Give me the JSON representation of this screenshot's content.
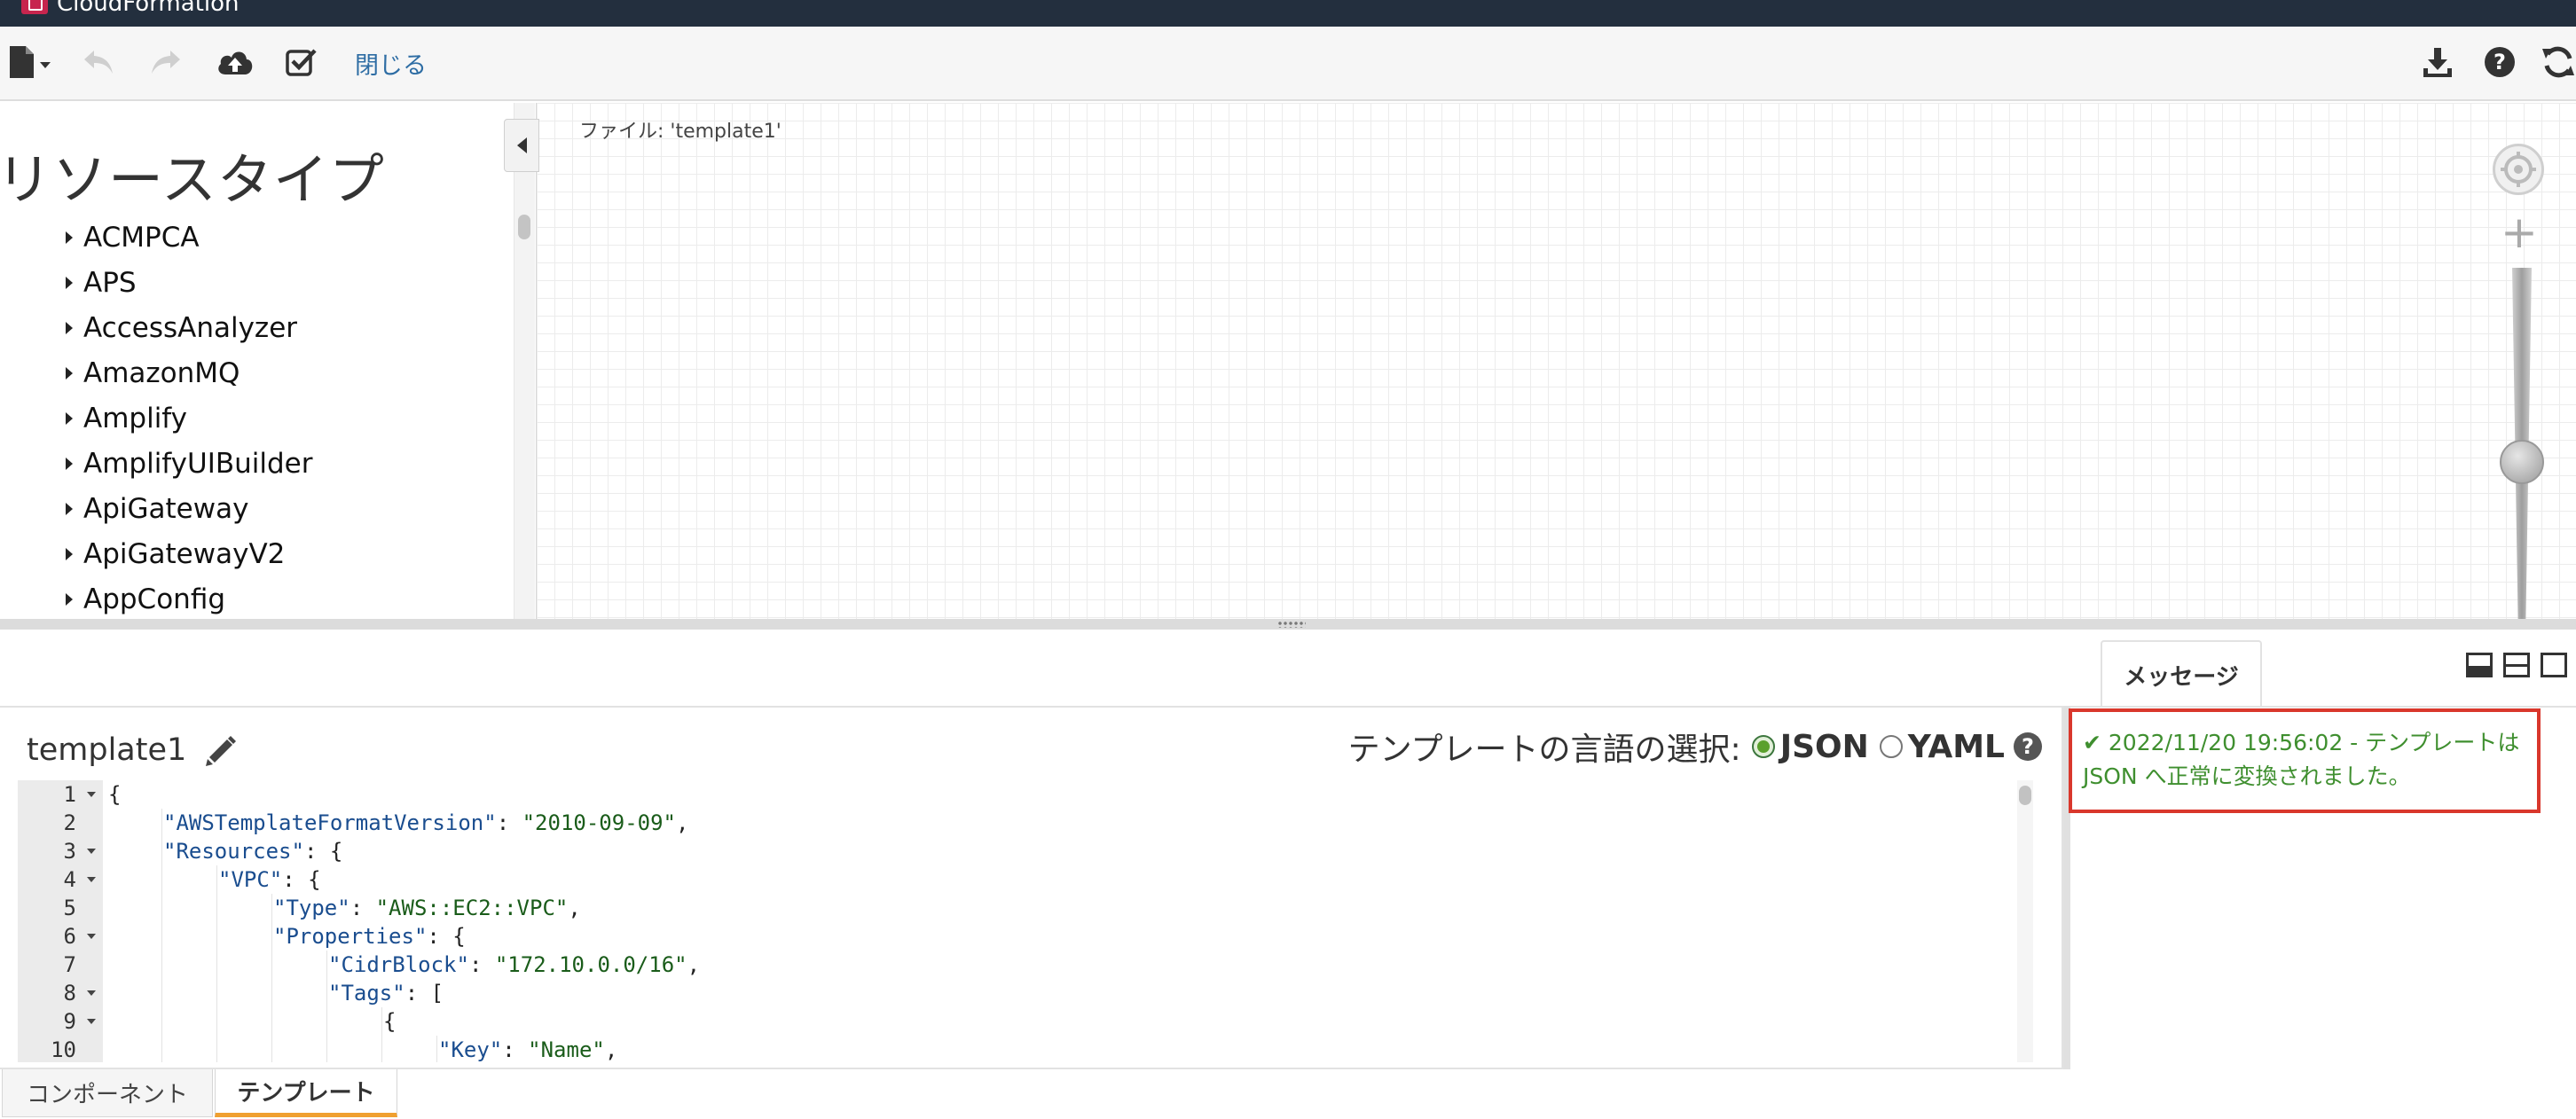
{
  "window": {
    "app_name": "CloudFormation"
  },
  "toolbar": {
    "close_label": "閉じる",
    "icons": [
      "file-icon",
      "undo-icon",
      "redo-icon",
      "cloud-upload-icon",
      "validate-icon",
      "download-icon",
      "help-icon",
      "refresh-icon"
    ]
  },
  "resources": {
    "title": "リソースタイプ",
    "items": [
      "ACMPCA",
      "APS",
      "AccessAnalyzer",
      "AmazonMQ",
      "Amplify",
      "AmplifyUIBuilder",
      "ApiGateway",
      "ApiGatewayV2",
      "AppConfig"
    ]
  },
  "canvas": {
    "file_label": "ファイル: 'template1'"
  },
  "editor": {
    "template_name": "template1",
    "lang_label": "テンプレートの言語の選択:",
    "lang_options": [
      "JSON",
      "YAML"
    ],
    "selected_lang": "JSON",
    "lines": [
      {
        "n": "1",
        "fold": true,
        "indent": 0,
        "key": "",
        "text": "{"
      },
      {
        "n": "2",
        "fold": false,
        "indent": 1,
        "key": "\"AWSTemplateFormatVersion\"",
        "sep": ": ",
        "val": "\"2010-09-09\"",
        "tail": ","
      },
      {
        "n": "3",
        "fold": true,
        "indent": 1,
        "key": "\"Resources\"",
        "sep": ": ",
        "val": "",
        "tail": "{"
      },
      {
        "n": "4",
        "fold": true,
        "indent": 2,
        "key": "\"VPC\"",
        "sep": ": ",
        "val": "",
        "tail": "{"
      },
      {
        "n": "5",
        "fold": false,
        "indent": 3,
        "key": "\"Type\"",
        "sep": ": ",
        "val": "\"AWS::EC2::VPC\"",
        "tail": ","
      },
      {
        "n": "6",
        "fold": true,
        "indent": 3,
        "key": "\"Properties\"",
        "sep": ": ",
        "val": "",
        "tail": "{"
      },
      {
        "n": "7",
        "fold": false,
        "indent": 4,
        "key": "\"CidrBlock\"",
        "sep": ": ",
        "val": "\"172.10.0.0/16\"",
        "tail": ","
      },
      {
        "n": "8",
        "fold": true,
        "indent": 4,
        "key": "\"Tags\"",
        "sep": ": ",
        "val": "",
        "tail": "["
      },
      {
        "n": "9",
        "fold": true,
        "indent": 5,
        "key": "",
        "text": "{"
      },
      {
        "n": "10",
        "fold": false,
        "indent": 6,
        "key": "\"Key\"",
        "sep": ": ",
        "val": "\"Name\"",
        "tail": ","
      }
    ]
  },
  "bottom_tabs": {
    "components": "コンポーネント",
    "template": "テンプレート",
    "active": "template"
  },
  "messages": {
    "tab_label": "メッセージ",
    "entry_line1": "2022/11/20 19:56:02 - テンプレートは",
    "entry_line2": "JSON へ正常に変換されました。",
    "status_color": "#3f8f2f",
    "highlight_color": "#d9372c"
  }
}
